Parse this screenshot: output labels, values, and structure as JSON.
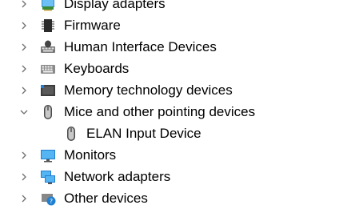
{
  "tree": {
    "items": [
      {
        "label": "Display adapters",
        "icon": "display-adapter-icon",
        "expanded": false
      },
      {
        "label": "Firmware",
        "icon": "firmware-chip-icon",
        "expanded": false
      },
      {
        "label": "Human Interface Devices",
        "icon": "hid-device-icon",
        "expanded": false
      },
      {
        "label": "Keyboards",
        "icon": "keyboard-icon",
        "expanded": false
      },
      {
        "label": "Memory technology devices",
        "icon": "memory-device-icon",
        "expanded": false
      },
      {
        "label": "Mice and other pointing devices",
        "icon": "mouse-icon",
        "expanded": true,
        "children": [
          {
            "label": "ELAN Input Device",
            "icon": "mouse-icon"
          }
        ]
      },
      {
        "label": "Monitors",
        "icon": "monitor-icon",
        "expanded": false
      },
      {
        "label": "Network adapters",
        "icon": "network-adapter-icon",
        "expanded": false
      },
      {
        "label": "Other devices",
        "icon": "unknown-device-icon",
        "expanded": false
      }
    ]
  },
  "colors": {
    "chevron": "#6e6e6e",
    "text": "#000000",
    "monitor_blue": "#2f8fd8",
    "device_gray": "#4a4a4a"
  }
}
